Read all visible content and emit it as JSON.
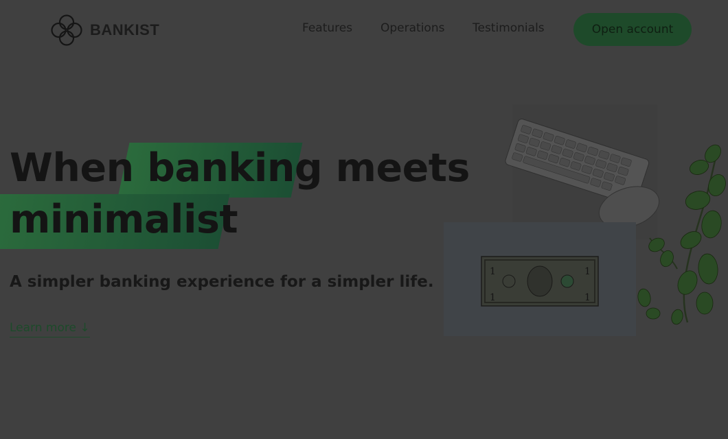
{
  "nav": {
    "logo_text": "BANKIST",
    "links": [
      "Features",
      "Operations",
      "Testimonials"
    ],
    "cta": "Open account"
  },
  "hero": {
    "title_line1_a": "When",
    "title_line1_b": "banking",
    "title_line1_c": "meets",
    "title_line2": "minimalist",
    "subtitle": "A simpler banking experience for a simpler life.",
    "learn_more": "Learn more ↓"
  },
  "colors": {
    "overlay": "#404040",
    "accent": "#1e4a2a",
    "highlight": "#2b6b3c"
  }
}
